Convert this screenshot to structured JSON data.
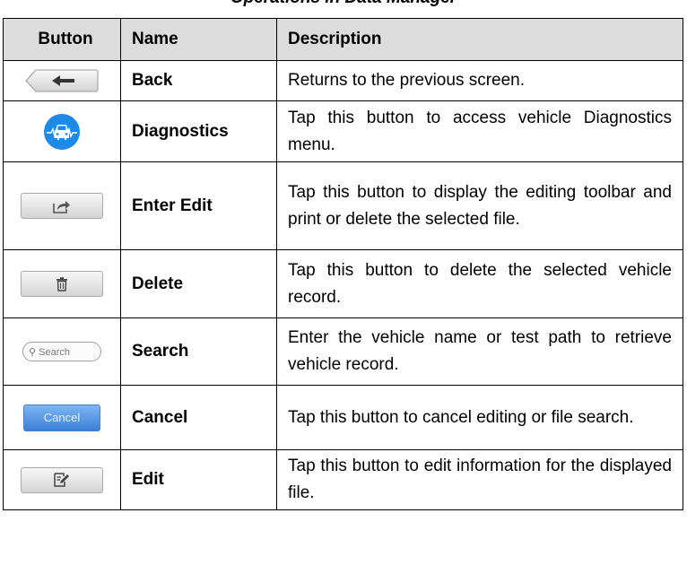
{
  "header": {
    "title_fragment": "Operations in Data Manager"
  },
  "table": {
    "columns": [
      "Button",
      "Name",
      "Description"
    ],
    "rows": [
      {
        "icon": "back-arrow-icon",
        "name": "Back",
        "description": "Returns to the previous screen."
      },
      {
        "icon": "car-diagnostics-icon",
        "name": "Diagnostics",
        "description": "Tap this button to access vehicle Diagnostics menu."
      },
      {
        "icon": "share-arrow-icon",
        "name": "Enter Edit",
        "description": "Tap this button to display the editing toolbar and print or delete the selected file."
      },
      {
        "icon": "trash-icon",
        "name": "Delete",
        "description": "Tap this button to delete the selected vehicle record."
      },
      {
        "icon": "search-icon",
        "name": "Search",
        "description": "Enter the vehicle name or test path to retrieve vehicle record.",
        "field_placeholder": "Search"
      },
      {
        "icon": "cancel-button-icon",
        "name": "Cancel",
        "description": "Tap this button to cancel editing or file search.",
        "button_label": "Cancel"
      },
      {
        "icon": "edit-note-icon",
        "name": "Edit",
        "description": "Tap this button to edit information for the displayed file."
      }
    ]
  },
  "colors": {
    "header_bg": "#dcdcdc",
    "diagnostics_blue": "#1e8ae6",
    "cancel_blue": "#3b7fd6"
  }
}
